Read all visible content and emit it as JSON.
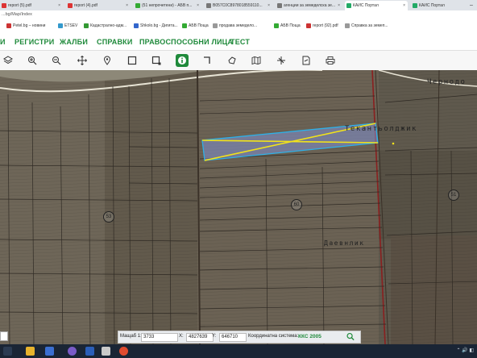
{
  "browser": {
    "tabs": [
      {
        "title": "report (5).pdf"
      },
      {
        "title": "report (4).pdf"
      },
      {
        "title": "(51 непрочетени) - АБВ п..."
      },
      {
        "title": "B057C0C8978018559110..."
      },
      {
        "title": "агенции за земеделска зе..."
      },
      {
        "title": "КАИС Портал"
      },
      {
        "title": "КАИС Портал"
      }
    ],
    "url": "...bg/Map/Index",
    "bookmarks": [
      {
        "label": "Petel.bg – новини"
      },
      {
        "label": "ETSEV"
      },
      {
        "label": "Кадастрално-адм..."
      },
      {
        "label": "Shkolo.bg - Дигита..."
      },
      {
        "label": "АБВ Поща"
      },
      {
        "label": "продава земедело..."
      },
      {
        "label": "АБВ Поща"
      },
      {
        "label": "report (92).pdf"
      },
      {
        "label": "Справка за земеп..."
      }
    ]
  },
  "menu": {
    "items": [
      {
        "label": "И"
      },
      {
        "label": "РЕГИСТРИ"
      },
      {
        "label": "ЖАЛБИ"
      },
      {
        "label": "СПРАВКИ"
      },
      {
        "label": "ПРАВОСПОСОБНИ ЛИЦА"
      },
      {
        "label": "ТЕСТ"
      }
    ]
  },
  "toolbar": {
    "tools": [
      {
        "icon": "layers-icon"
      },
      {
        "icon": "zoom-in-icon"
      },
      {
        "icon": "zoom-out-icon"
      },
      {
        "icon": "pan-icon"
      },
      {
        "icon": "location-pin-icon"
      },
      {
        "icon": "select-rectangle-icon"
      },
      {
        "icon": "select-area-icon"
      },
      {
        "icon": "info-icon"
      },
      {
        "icon": "measure-distance-icon"
      },
      {
        "icon": "measure-area-icon"
      },
      {
        "icon": "map-icon"
      },
      {
        "icon": "ruler-icon"
      },
      {
        "icon": "export-icon"
      },
      {
        "icon": "print-icon"
      }
    ]
  },
  "map": {
    "labels": {
      "chernod": "Чернодо",
      "tekante": "Текантьолджик",
      "daevi": "Даевнлик"
    },
    "parcels": [
      "53",
      "60",
      "51"
    ]
  },
  "status": {
    "scale_label": "Мащаб 1:",
    "scale_value": "3733",
    "x_label": "X:",
    "x_value": "4827639",
    "y_label": "Y:",
    "y_value": "646710",
    "system_label": "Координатна система:",
    "system_value": "ККС 2005"
  },
  "colors": {
    "accent": "#1f8a3b",
    "parcel_fill": "#7f8fd0",
    "parcel_stroke": "#2fb0e6",
    "diagonal": "#f1e21b",
    "boundary": "#8a1f1f"
  }
}
